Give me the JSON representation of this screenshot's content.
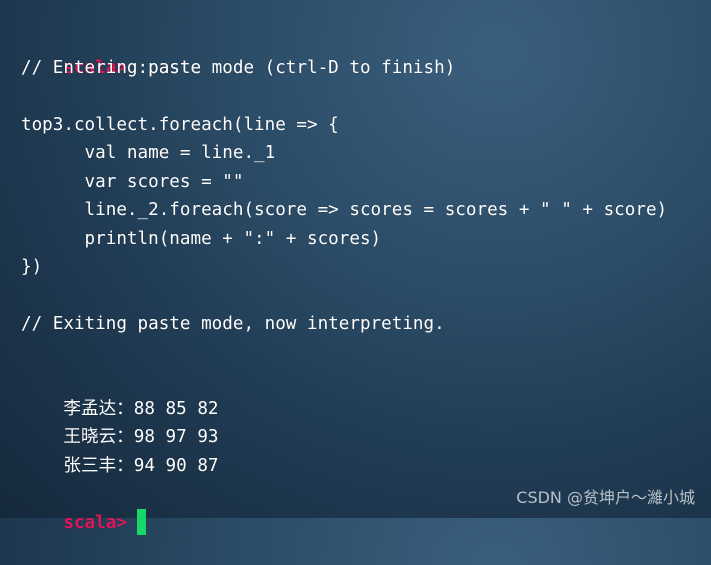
{
  "terminal": {
    "prompt": "scala>",
    "colors": {
      "prompt": "#e0155a",
      "text": "#ffffff",
      "cursor": "#17d66a",
      "background": "#2c4d68"
    },
    "lines": {
      "l1_cmd": " :paste",
      "l2": "// Entering paste mode (ctrl-D to finish)",
      "l4": "top3.collect.foreach(line => {",
      "l5": "      val name = line._1",
      "l6": "      var scores = \"\"",
      "l7": "      line._2.foreach(score => scores = scores + \" \" + score)",
      "l8": "      println(name + \":\" + scores)",
      "l9": "})",
      "l11": "// Exiting paste mode, now interpreting.",
      "r1_name": "李孟达：",
      "r1_scores": "88 85 82",
      "r2_name": "王晓云：",
      "r2_scores": "98 97 93",
      "r3_name": "张三丰：",
      "r3_scores": "94 90 87"
    }
  },
  "watermark": "CSDN @贫坤户～濰小城"
}
